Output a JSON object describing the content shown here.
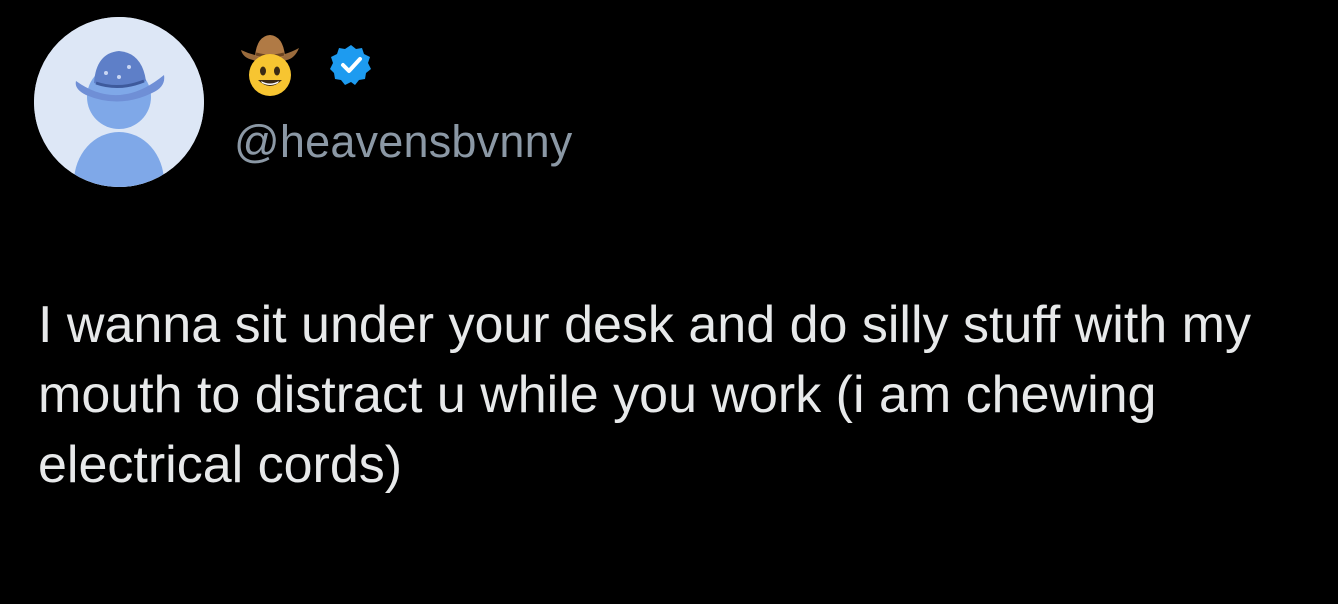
{
  "tweet": {
    "handle": "@heavensbvnny",
    "text": "I wanna sit under your desk and do silly stuff with my mouth to distract u while you work (i am chewing electrical cords)",
    "display_name_emoji": "cowboy-face-icon",
    "verified": true
  },
  "colors": {
    "background": "#000000",
    "text": "#e7e9ea",
    "handle": "#8b98a5",
    "verified_badge": "#1d9bf0",
    "avatar_bg": "#dde7f6",
    "avatar_figure": "#7fa8e8"
  }
}
